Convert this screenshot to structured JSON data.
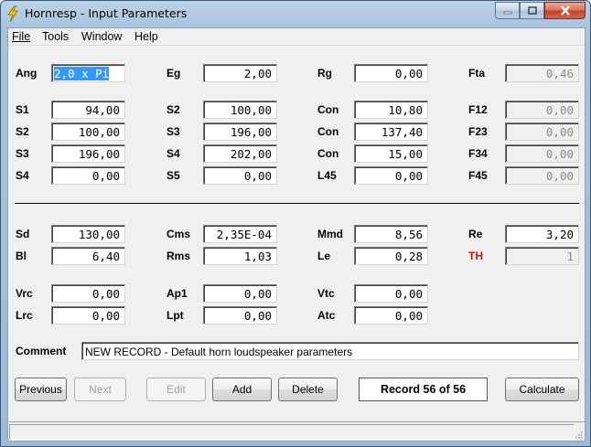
{
  "window": {
    "title": "Hornresp - Input Parameters"
  },
  "menu": {
    "file": "File",
    "tools": "Tools",
    "window": "Window",
    "help": "Help"
  },
  "fields": {
    "ang": {
      "label": "Ang",
      "value": "2,0 x Pi"
    },
    "eg": {
      "label": "Eg",
      "value": "2,00"
    },
    "rg": {
      "label": "Rg",
      "value": "0,00"
    },
    "fta": {
      "label": "Fta",
      "value": "0,46"
    },
    "s1": {
      "label": "S1",
      "value": "94,00"
    },
    "s2a": {
      "label": "S2",
      "value": "100,00"
    },
    "con1": {
      "label": "Con",
      "value": "10,80"
    },
    "f12": {
      "label": "F12",
      "value": "0,00"
    },
    "s2b": {
      "label": "S2",
      "value": "100,00"
    },
    "s3a": {
      "label": "S3",
      "value": "196,00"
    },
    "con2": {
      "label": "Con",
      "value": "137,40"
    },
    "f23": {
      "label": "F23",
      "value": "0,00"
    },
    "s3b": {
      "label": "S3",
      "value": "196,00"
    },
    "s4a": {
      "label": "S4",
      "value": "202,00"
    },
    "con3": {
      "label": "Con",
      "value": "15,00"
    },
    "f34": {
      "label": "F34",
      "value": "0,00"
    },
    "s4b": {
      "label": "S4",
      "value": "0,00"
    },
    "s5": {
      "label": "S5",
      "value": "0,00"
    },
    "l45": {
      "label": "L45",
      "value": "0,00"
    },
    "f45": {
      "label": "F45",
      "value": "0,00"
    },
    "sd": {
      "label": "Sd",
      "value": "130,00"
    },
    "cms": {
      "label": "Cms",
      "value": "2,35E-04"
    },
    "mmd": {
      "label": "Mmd",
      "value": "8,56"
    },
    "re": {
      "label": "Re",
      "value": "3,20"
    },
    "bl": {
      "label": "Bl",
      "value": "6,40"
    },
    "rms": {
      "label": "Rms",
      "value": "1,03"
    },
    "le": {
      "label": "Le",
      "value": "0,28"
    },
    "th": {
      "label": "TH",
      "value": "1"
    },
    "vrc": {
      "label": "Vrc",
      "value": "0,00"
    },
    "ap1": {
      "label": "Ap1",
      "value": "0,00"
    },
    "vtc": {
      "label": "Vtc",
      "value": "0,00"
    },
    "lrc": {
      "label": "Lrc",
      "value": "0,00"
    },
    "lpt": {
      "label": "Lpt",
      "value": "0,00"
    },
    "atc": {
      "label": "Atc",
      "value": "0,00"
    }
  },
  "comment": {
    "label": "Comment",
    "value": "NEW RECORD - Default horn loudspeaker parameters"
  },
  "buttons": {
    "previous": "Previous",
    "next": "Next",
    "edit": "Edit",
    "add": "Add",
    "delete": "Delete",
    "calculate": "Calculate"
  },
  "record": {
    "text": "Record 56 of 56"
  },
  "colors": {
    "th_label": "#d01010",
    "selection": "#3399ff"
  }
}
